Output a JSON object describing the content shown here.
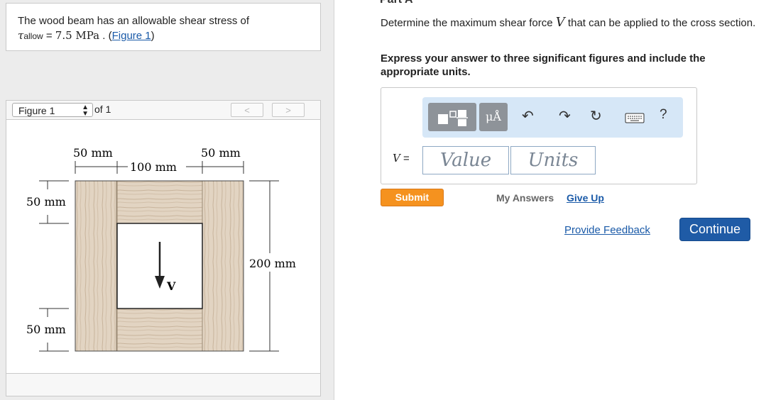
{
  "problem": {
    "statement": "The wood beam has an allowable shear stress of",
    "tau_symbol": "τ",
    "tau_subscript": "allow",
    "equals": "= ",
    "value": "7.5 MPa",
    "separator": " . (",
    "figure_link": "Figure 1",
    "close": ")"
  },
  "figure_nav": {
    "selected": "Figure 1",
    "of_total": "of 1",
    "prev": "<",
    "next": ">"
  },
  "figure": {
    "dim_top_left": "50 mm",
    "dim_top_mid": "100 mm",
    "dim_top_right": "50 mm",
    "dim_left_top": "50 mm",
    "dim_left_bottom": "50 mm",
    "dim_right": "200 mm",
    "force_label": "V"
  },
  "part": {
    "title": "Part A",
    "question_pre": "Determine the maximum shear force ",
    "question_var": "V",
    "question_post": " that can be applied to the cross section.",
    "instructions": "Express your answer to three significant figures and include the appropriate units."
  },
  "toolbar": {
    "units_btn": "μÅ",
    "help": "?"
  },
  "answer": {
    "var": "V",
    "equals": "=",
    "value_placeholder": "Value",
    "units_placeholder": "Units"
  },
  "actions": {
    "submit": "Submit",
    "my_answers": "My Answers",
    "give_up": "Give Up",
    "feedback": "Provide Feedback",
    "continue": "Continue"
  },
  "colors": {
    "submit": "#f5921f",
    "continue": "#1f5ba6",
    "link": "#1a5aa8",
    "toolbar": "#d6e7f7"
  }
}
